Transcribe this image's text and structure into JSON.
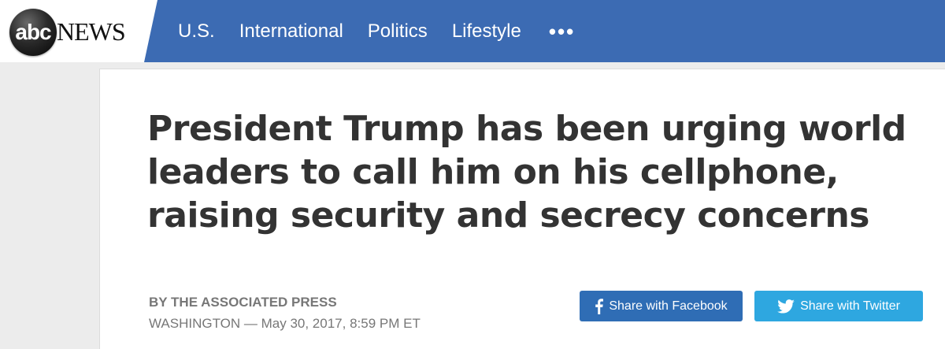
{
  "brand": {
    "logo_abc": "abc",
    "logo_news": "NEWS"
  },
  "nav": {
    "items": [
      "U.S.",
      "International",
      "Politics",
      "Lifestyle"
    ],
    "more": "•••"
  },
  "article": {
    "headline": "President Trump has been urging world leaders to call him on his cellphone, raising security and secrecy concerns",
    "byline": "By THE ASSOCIATED PRESS",
    "dateline": "WASHINGTON — May 30, 2017, 8:59 PM ET"
  },
  "share": {
    "facebook_label": "Share with Facebook",
    "twitter_label": "Share with Twitter"
  },
  "colors": {
    "header_bg": "#3c6bb3",
    "facebook": "#2f6db5",
    "twitter": "#2ea7e0",
    "headline": "#333333"
  },
  "icons": {
    "facebook": "facebook-icon",
    "twitter": "twitter-icon",
    "more": "more-icon"
  }
}
